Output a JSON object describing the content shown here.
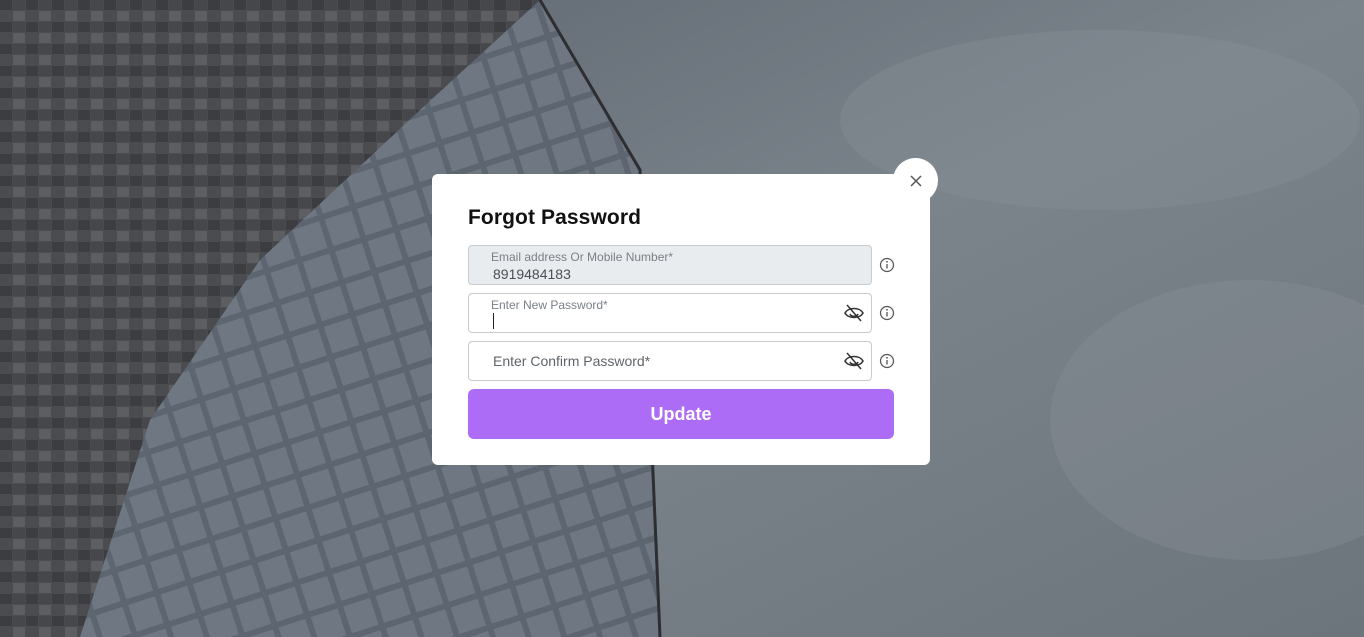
{
  "modal": {
    "title": "Forgot Password",
    "close_icon": "close-icon",
    "fields": [
      {
        "label": "Email address Or Mobile Number*",
        "value": "8919484183",
        "readonly": true
      },
      {
        "label": "Enter New Password*",
        "value": "",
        "toggle_icon": "eye-off-icon"
      },
      {
        "placeholder": "Enter Confirm Password*",
        "value": "",
        "toggle_icon": "eye-off-icon"
      }
    ],
    "info_icon": "info-icon",
    "submit_label": "Update",
    "accent_color": "#ad6cf5"
  }
}
